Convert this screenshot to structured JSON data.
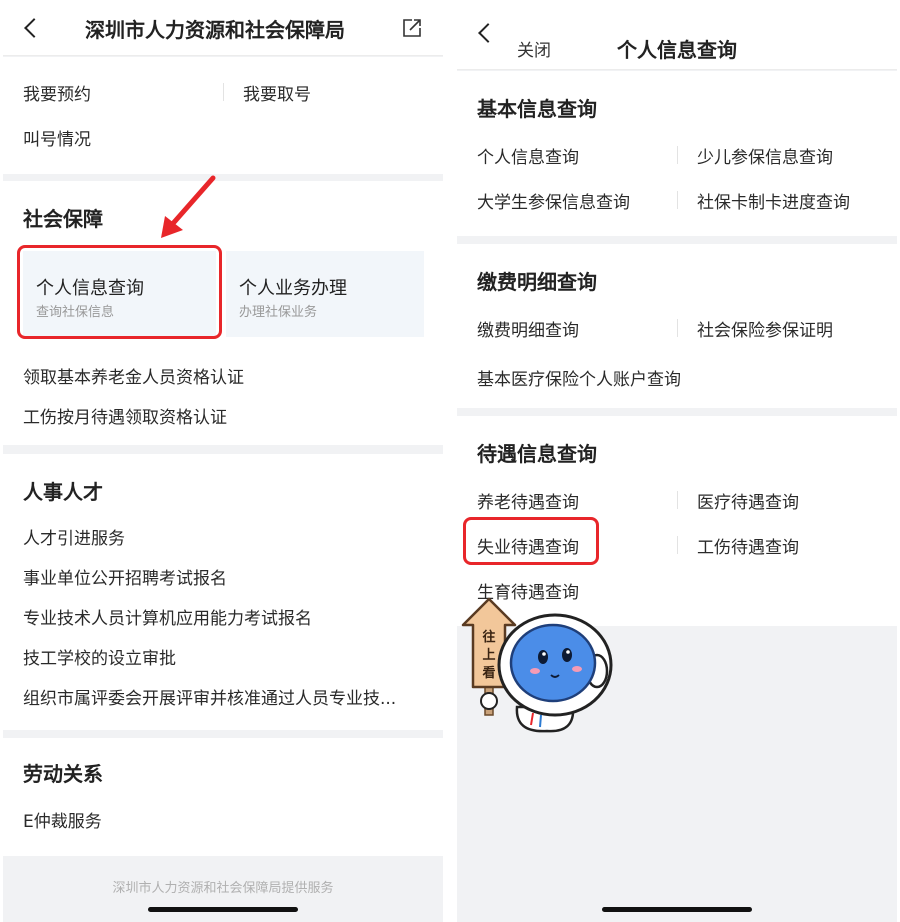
{
  "left": {
    "header": {
      "title": "深圳市人力资源和社会保障局",
      "back_icon": "chevron-left-icon",
      "share_icon": "share-icon"
    },
    "quick": {
      "items": [
        "我要预约",
        "我要取号",
        "叫号情况"
      ]
    },
    "social": {
      "title": "社会保障",
      "tiles": [
        {
          "title": "个人信息查询",
          "subtitle": "查询社保信息"
        },
        {
          "title": "个人业务办理",
          "subtitle": "办理社保业务"
        }
      ],
      "items": [
        "领取基本养老金人员资格认证",
        "工伤按月待遇领取资格认证"
      ]
    },
    "talent": {
      "title": "人事人才",
      "items": [
        "人才引进服务",
        "事业单位公开招聘考试报名",
        "专业技术人员计算机应用能力考试报名",
        "技工学校的设立审批",
        "组织市属评委会开展评审并核准通过人员专业技..."
      ]
    },
    "labor": {
      "title": "劳动关系",
      "items": [
        "E仲裁服务"
      ]
    },
    "footer": "深圳市人力资源和社会保障局提供服务"
  },
  "right": {
    "header": {
      "close_label": "关闭",
      "title": "个人信息查询",
      "back_icon": "chevron-left-icon"
    },
    "basic": {
      "title": "基本信息查询",
      "items": [
        "个人信息查询",
        "少儿参保信息查询",
        "大学生参保信息查询",
        "社保卡制卡进度查询"
      ]
    },
    "payment": {
      "title": "缴费明细查询",
      "items": [
        "缴费明细查询",
        "社会保险参保证明",
        "基本医疗保险个人账户查询"
      ]
    },
    "benefit": {
      "title": "待遇信息查询",
      "items": [
        "养老待遇查询",
        "医疗待遇查询",
        "失业待遇查询",
        "工伤待遇查询",
        "生育待遇查询"
      ]
    },
    "mascot": {
      "sign_text": [
        "往",
        "上",
        "看"
      ],
      "icon": "mascot-icon"
    }
  },
  "colors": {
    "highlight": "#e8262a",
    "tile_bg": "#f2f6fa",
    "page_bg": "#f1f2f4"
  }
}
